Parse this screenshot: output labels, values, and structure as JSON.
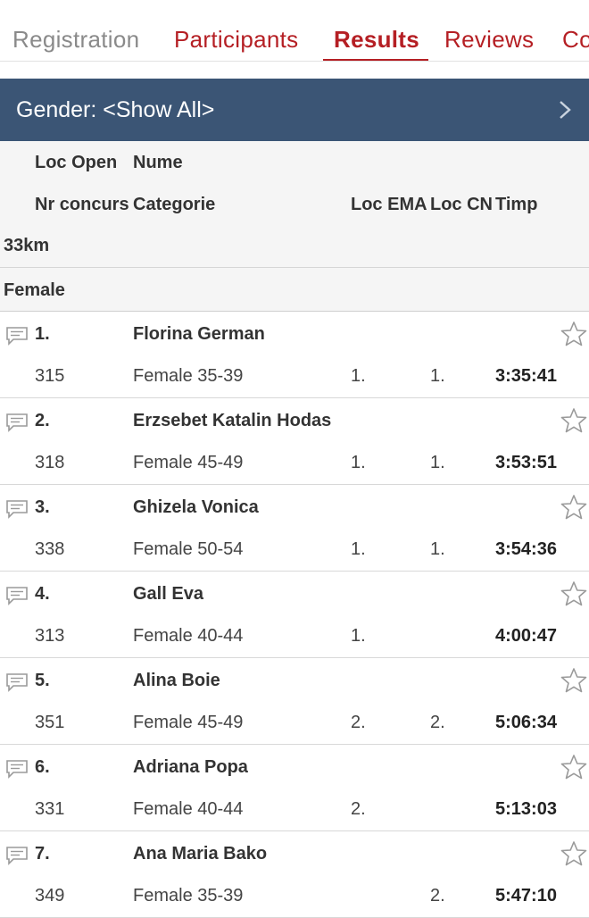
{
  "tabs": [
    {
      "label": "Registration",
      "state": "inactive"
    },
    {
      "label": "Participants",
      "state": "link"
    },
    {
      "label": "Results",
      "state": "active"
    },
    {
      "label": "Reviews",
      "state": "link"
    },
    {
      "label": "Co",
      "state": "link"
    }
  ],
  "filter": {
    "label": "Gender: <Show All>",
    "icon": "chevron-right-icon"
  },
  "header": {
    "row1": {
      "loc_open": "Loc Open",
      "nume": "Nume"
    },
    "row2": {
      "nr_concurs": "Nr concurs",
      "categorie": "Categorie",
      "loc_ema": "Loc EMA",
      "loc_cn": "Loc CN",
      "timp": "Timp"
    }
  },
  "distance": "33km",
  "group": "Female",
  "entries": [
    {
      "place": "1.",
      "name": "Florina German",
      "bib": "315",
      "category": "Female 35-39",
      "loc_ema": "1.",
      "loc_cn": "1.",
      "time": "3:35:41"
    },
    {
      "place": "2.",
      "name": "Erzsebet Katalin Hodas",
      "bib": "318",
      "category": "Female 45-49",
      "loc_ema": "1.",
      "loc_cn": "1.",
      "time": "3:53:51"
    },
    {
      "place": "3.",
      "name": "Ghizela Vonica",
      "bib": "338",
      "category": "Female 50-54",
      "loc_ema": "1.",
      "loc_cn": "1.",
      "time": "3:54:36"
    },
    {
      "place": "4.",
      "name": "Gall Eva",
      "bib": "313",
      "category": "Female 40-44",
      "loc_ema": "1.",
      "loc_cn": "",
      "time": "4:00:47"
    },
    {
      "place": "5.",
      "name": "Alina Boie",
      "bib": "351",
      "category": "Female 45-49",
      "loc_ema": "2.",
      "loc_cn": "2.",
      "time": "5:06:34"
    },
    {
      "place": "6.",
      "name": "Adriana Popa",
      "bib": "331",
      "category": "Female 40-44",
      "loc_ema": "2.",
      "loc_cn": "",
      "time": "5:13:03"
    },
    {
      "place": "7.",
      "name": "Ana Maria Bako",
      "bib": "349",
      "category": "Female 35-39",
      "loc_ema": "",
      "loc_cn": "2.",
      "time": "5:47:10"
    }
  ],
  "colors": {
    "accent": "#b51f24",
    "filter_bg": "#3b5575",
    "header_bg": "#f5f5f5"
  }
}
